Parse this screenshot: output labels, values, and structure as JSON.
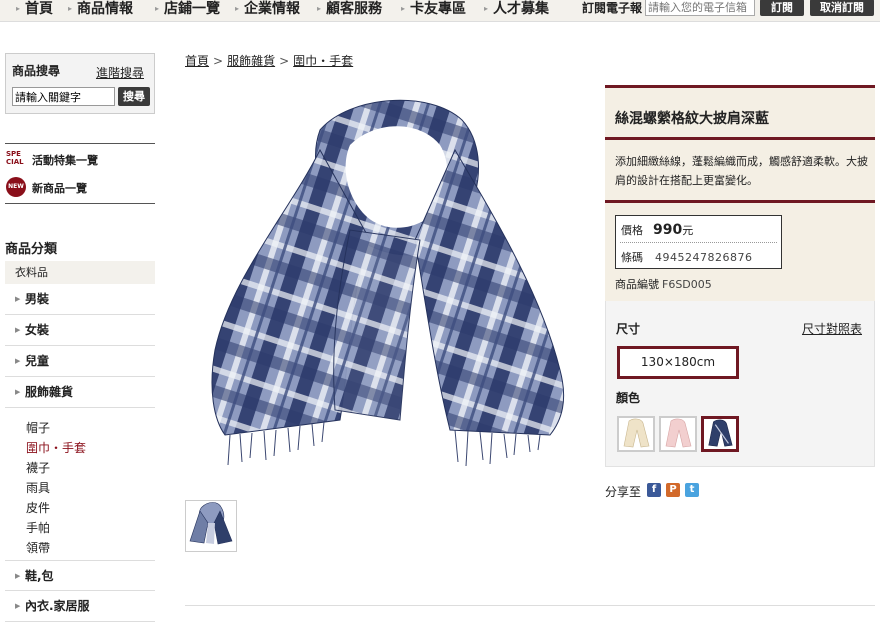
{
  "nav": {
    "items": [
      "首頁",
      "商品情報",
      "店鋪一覽",
      "企業情報",
      "顧客服務",
      "卡友專區",
      "人才募集"
    ],
    "subscribe_label": "訂閱電子報",
    "subscribe_placeholder": "請輸入您的電子信箱",
    "subscribe_button": "訂閱",
    "unsubscribe_button": "取消訂閱"
  },
  "sidebar": {
    "search_title": "商品搜尋",
    "advanced_link": "進階搜尋",
    "search_value": "請輸入關鍵字",
    "search_button": "搜尋",
    "special_icon": "SPE CIAL",
    "special_label": "活動特集一覽",
    "new_icon": "NEW",
    "new_label": "新商品一覽",
    "category_title": "商品分類",
    "category_head": "衣料品",
    "categories": [
      "男裝",
      "女裝",
      "兒童",
      "服飾雜貨"
    ],
    "subcategories": [
      "帽子",
      "圍巾・手套",
      "襪子",
      "雨具",
      "皮件",
      "手帕",
      "領帶"
    ],
    "active_subcategory": "圍巾・手套",
    "more_categories": [
      "鞋,包",
      "內衣.家居服"
    ]
  },
  "breadcrumb": [
    "首頁",
    "服飾雜貨",
    "圍巾・手套"
  ],
  "product": {
    "title": "絲混螺縈格紋大披肩深藍",
    "description": "添加細緻絲線，蓬鬆編織而成，觸感舒適柔軟。大披肩的設計在搭配上更富變化。",
    "price_label": "價格",
    "price_value": "990",
    "price_unit": "元",
    "barcode_label": "條碼",
    "barcode_value": "4945247826876",
    "sku_label": "商品編號",
    "sku_value": "F6SD005",
    "size_label": "尺寸",
    "size_chart_link": "尺寸對照表",
    "size_option": "130×180cm",
    "color_label": "顏色",
    "colors": [
      "#efe3c8",
      "#f2cfcf",
      "#2f3f6a"
    ],
    "selected_color_index": 2
  },
  "share": {
    "label": "分享至",
    "icons": [
      "facebook-icon",
      "plurk-icon",
      "twitter-icon"
    ]
  },
  "colors": {
    "accent": "#6f1822",
    "panel": "#f4efe4"
  }
}
